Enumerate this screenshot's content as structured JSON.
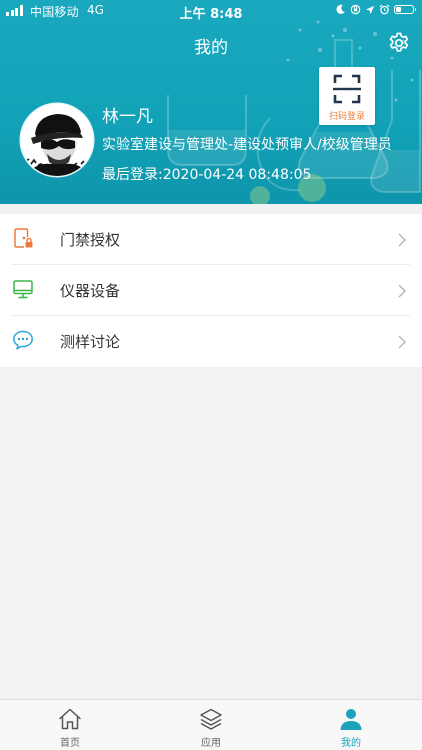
{
  "status_bar": {
    "carrier": "中国移动",
    "network": "4G",
    "time": "上午 8:48",
    "battery_level": 0.3
  },
  "header": {
    "title": "我的",
    "scan_label": "扫码登录"
  },
  "profile": {
    "name": "林一凡",
    "department": "实验室建设与管理处-建设处预审人/校级管理员",
    "last_login": "最后登录:2020-04-24 08:48:05"
  },
  "menu": [
    {
      "label": "门禁授权",
      "icon": "door-access-icon",
      "color": "#f07a3c"
    },
    {
      "label": "仪器设备",
      "icon": "monitor-icon",
      "color": "#3cb44a"
    },
    {
      "label": "测样讨论",
      "icon": "chat-bubble-icon",
      "color": "#2fa6d8"
    }
  ],
  "tabs": [
    {
      "label": "首页",
      "icon": "home-icon",
      "active": false
    },
    {
      "label": "应用",
      "icon": "layers-icon",
      "active": false
    },
    {
      "label": "我的",
      "icon": "person-icon",
      "active": true
    }
  ],
  "colors": {
    "header_bg": "#15a4b9",
    "accent": "#1aa3bb",
    "scan_text": "#e8843a"
  }
}
